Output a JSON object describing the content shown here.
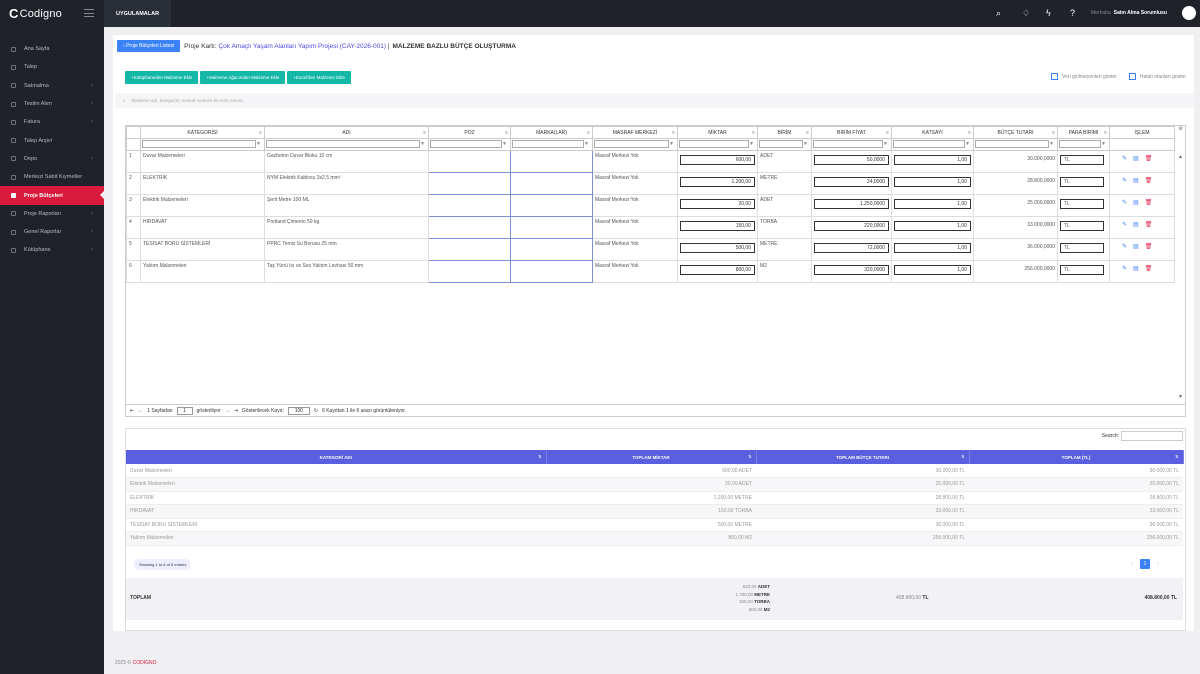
{
  "app": {
    "brand": "Codigno",
    "apps_label": "UYGULAMALAR",
    "welcome": "Merhaba",
    "user": "Satın Alma Sorumlusu"
  },
  "sidebar": {
    "items": [
      {
        "label": "Ana Sayfa",
        "chev": false
      },
      {
        "label": "Talep",
        "chev": false
      },
      {
        "label": "Satınalma",
        "chev": true
      },
      {
        "label": "Teslim Alım",
        "chev": true
      },
      {
        "label": "Fatura",
        "chev": true
      },
      {
        "label": "Talep Arşivi",
        "chev": false
      },
      {
        "label": "Depo",
        "chev": true
      },
      {
        "label": "Merkezi Sabit Kıymetler",
        "chev": false
      },
      {
        "label": "Proje Bütçeleri",
        "chev": false,
        "active": true
      },
      {
        "label": "Proje Raporları",
        "chev": true
      },
      {
        "label": "Genel Raporlar",
        "chev": true
      },
      {
        "label": "Kütüphane",
        "chev": true
      }
    ]
  },
  "header": {
    "back": "Proje Bütçeleri Listesi",
    "prefix": "Proje Kartı:",
    "project": "Çok Amaçlı Yaşam Alanları Yapım Projesi (CAY-2026-001)",
    "sep": "|",
    "title": "MALZEME BAZLU BÜTÇE OLUŞTURMA"
  },
  "actions": [
    "Kütüphaneden Malzeme Ekle",
    "Malzeme Ağacından Malzeme Ekle",
    "Excel'den Malzeme Ekle"
  ],
  "checks": [
    "Veri girilmeyenleri göster",
    "Hatalı olanları göster"
  ],
  "search_placeholder": "Malzeme adı, kategorisi, masraf merkezi ile Hızlı Arama",
  "grid": {
    "columns": [
      "",
      "KATEGORİSİ",
      "ADI",
      "POZ",
      "MARKA(LAR)",
      "MASRAF MERKEZİ",
      "MİKTAR",
      "BİRİM",
      "BİRİM FİYAT",
      "KATSAYI",
      "BÜTÇE TUTARI",
      "PARA BİRİMİ",
      "İŞLEM"
    ],
    "rows": [
      {
        "n": "1",
        "kat": "Duvar Malzemeleri",
        "adi": "Gazbeton Duvar Bloku 10 cm",
        "mm": "Masraf Merkezi Yok",
        "miktar": "600,00",
        "birim": "ADET",
        "fiyat": "50,0000",
        "katsayi": "1,00",
        "tutar": "30.000,0000",
        "pb": "TL"
      },
      {
        "n": "2",
        "kat": "ELEKTRİK",
        "adi": "NYM Elektrik Kablosu 3x2,5 mm²",
        "mm": "Masraf Merkezi Yok",
        "miktar": "1.200,00",
        "birim": "METRE",
        "fiyat": "24,0000",
        "katsayi": "1,00",
        "tutar": "28.800,0000",
        "pb": "TL"
      },
      {
        "n": "3",
        "kat": "Elektrik Malzemeleri",
        "adi": "Şerit Metre 100 ML",
        "mm": "Masraf Merkezi Yok",
        "miktar": "20,00",
        "birim": "ADET",
        "fiyat": "1.250,0000",
        "katsayi": "1,00",
        "tutar": "25.000,0000",
        "pb": "TL"
      },
      {
        "n": "4",
        "kat": "HIRDAVAT",
        "adi": "Portland Çimento 50 kg",
        "mm": "Masraf Merkezi Yok",
        "miktar": "150,00",
        "birim": "TORBA",
        "fiyat": "220,0000",
        "katsayi": "1,00",
        "tutar": "33.000,0000",
        "pb": "TL"
      },
      {
        "n": "5",
        "kat": "TESİSAT BORU SİSTEMLERİ",
        "adi": "PPRC Temiz Su Borusu 25 mm",
        "mm": "Masraf Merkezi Yok",
        "miktar": "500,00",
        "birim": "METRE",
        "fiyat": "72,0000",
        "katsayi": "1,00",
        "tutar": "36.000,0000",
        "pb": "TL"
      },
      {
        "n": "6",
        "kat": "Yalıtım Malzemeleri",
        "adi": "Taş Yünü Isı ve Ses Yalıtım Levhası 50 mm",
        "mm": "Masraf Merkezi Yok",
        "miktar": "800,00",
        "birim": "M2",
        "fiyat": "320,0000",
        "katsayi": "1,00",
        "tutar": "256.000,0000",
        "pb": "TL"
      }
    ],
    "pager": {
      "page_label": "1 Sayfadan",
      "page": "1",
      "shown": "gösteriliyor",
      "per_label": "Gösterilecek Kayıt:",
      "per": "100",
      "info": "6 Kayıttan 1 ile 6 arası görüntüleniyor."
    }
  },
  "summary": {
    "search_label": "Search:",
    "columns": [
      "KATEGORİ ADI",
      "TOPLAM MİKTAR",
      "TOPLAM BÜTÇE TUTARI",
      "TOPLAM (TL)"
    ],
    "rows": [
      {
        "kat": "Duvar Malzemeleri",
        "mik": "600,00 ADET",
        "but": "30.000,00 TL",
        "top": "30.000,00 TL"
      },
      {
        "kat": "Elektrik Malzemeleri",
        "mik": "20,00 ADET",
        "but": "25.000,00 TL",
        "top": "25.000,00 TL"
      },
      {
        "kat": "ELEKTRİK",
        "mik": "1.200,00 METRE",
        "but": "28.800,00 TL",
        "top": "28.800,00 TL"
      },
      {
        "kat": "HIRDAVAT",
        "mik": "150,00 TORBA",
        "but": "33.000,00 TL",
        "top": "33.000,00 TL"
      },
      {
        "kat": "TESİSAT BORU SİSTEMLERİ",
        "mik": "500,00 METRE",
        "but": "36.000,00 TL",
        "top": "36.000,00 TL"
      },
      {
        "kat": "Yalıtım Malzemeleri",
        "mik": "800,00 M2",
        "but": "256.000,00 TL",
        "top": "256.000,00 TL"
      }
    ],
    "showing": "Showing 1 to 6 of 6 entries",
    "page": "1",
    "total_label": "TOPLAM",
    "total_qty": [
      [
        "620,00",
        "ADET"
      ],
      [
        "1.700,00",
        "METRE"
      ],
      [
        "150,00",
        "TORBA"
      ],
      [
        "800,00",
        "M2"
      ]
    ],
    "total_budget_val": "408.800,00",
    "total_budget_cur": "TL",
    "total_tl": "408.800,00 TL"
  },
  "footer": {
    "year": "2025 ©",
    "brand": "CODIGNO"
  }
}
